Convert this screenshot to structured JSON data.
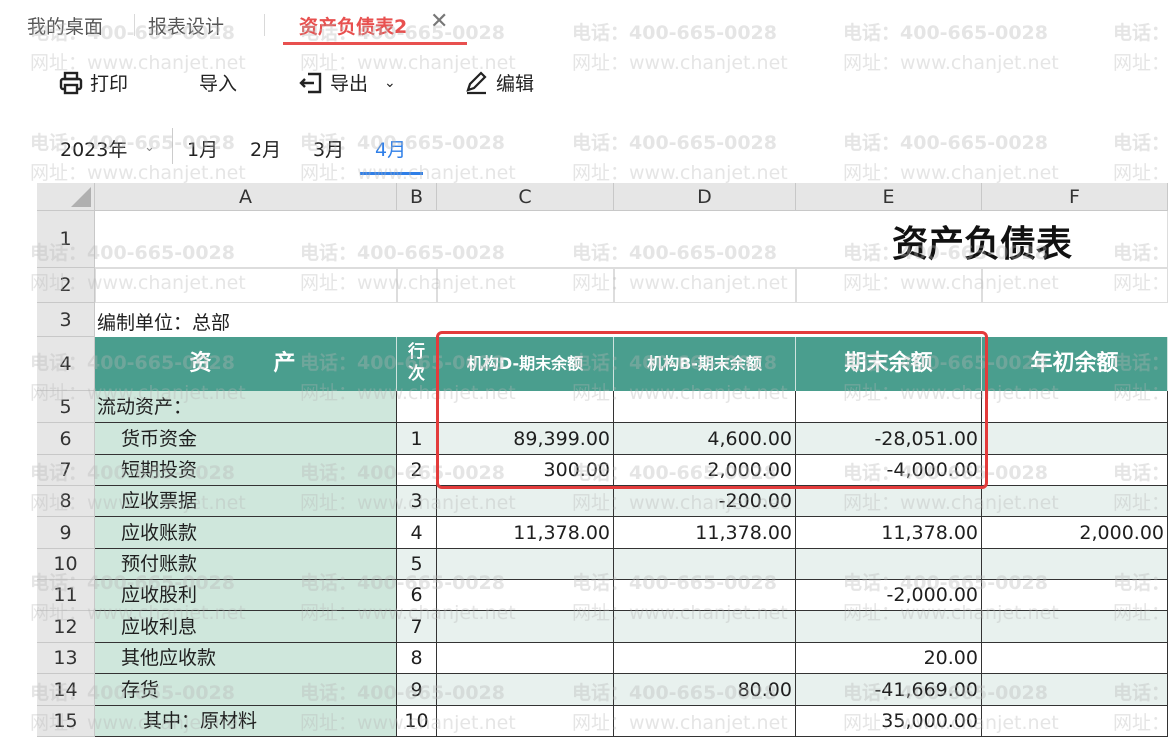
{
  "tabs": [
    {
      "label": "我的桌面"
    },
    {
      "label": "报表设计"
    },
    {
      "label": "资产负债表2",
      "active": true
    }
  ],
  "toolbar": {
    "print": "打印",
    "import": "导入",
    "export": "导出",
    "edit": "编辑"
  },
  "period": {
    "year": "2023年",
    "months": [
      "1月",
      "2月",
      "3月",
      "4月"
    ],
    "active_month": "4月"
  },
  "columns": [
    "A",
    "B",
    "C",
    "D",
    "E",
    "F"
  ],
  "sheet": {
    "title": "资产负债表",
    "unit": "编制单位：总部",
    "headers": {
      "assets": "资　　产",
      "line": "行\n次",
      "c": "机构D-期末余额",
      "d": "机构B-期末余额",
      "e": "期末余额",
      "f": "年初余额"
    },
    "rows": [
      {
        "n": "5",
        "a": "流动资产：",
        "b": "",
        "c": "",
        "d": "",
        "e": "",
        "f": ""
      },
      {
        "n": "6",
        "a": "货币资金",
        "b": "1",
        "c": "89,399.00",
        "d": "4,600.00",
        "e": "-28,051.00",
        "f": ""
      },
      {
        "n": "7",
        "a": "短期投资",
        "b": "2",
        "c": "300.00",
        "d": "2,000.00",
        "e": "-4,000.00",
        "f": ""
      },
      {
        "n": "8",
        "a": "应收票据",
        "b": "3",
        "c": "",
        "d": "-200.00",
        "e": "",
        "f": ""
      },
      {
        "n": "9",
        "a": "应收账款",
        "b": "4",
        "c": "11,378.00",
        "d": "11,378.00",
        "e": "11,378.00",
        "f": "2,000.00"
      },
      {
        "n": "10",
        "a": "预付账款",
        "b": "5",
        "c": "",
        "d": "",
        "e": "",
        "f": ""
      },
      {
        "n": "11",
        "a": "应收股利",
        "b": "6",
        "c": "",
        "d": "",
        "e": "-2,000.00",
        "f": ""
      },
      {
        "n": "12",
        "a": "应收利息",
        "b": "7",
        "c": "",
        "d": "",
        "e": "",
        "f": ""
      },
      {
        "n": "13",
        "a": "其他应收款",
        "b": "8",
        "c": "",
        "d": "",
        "e": "20.00",
        "f": ""
      },
      {
        "n": "14",
        "a": "存货",
        "b": "9",
        "c": "",
        "d": "80.00",
        "e": "-41,669.00",
        "f": ""
      },
      {
        "n": "15",
        "a": "其中：原材料",
        "b": "10",
        "c": "",
        "d": "",
        "e": "35,000.00",
        "f": ""
      }
    ]
  },
  "watermark": {
    "phone": "电话：400-665-0028",
    "site": "网址：www.chanjet.net"
  },
  "colors": {
    "accent_tab": "#e8504f",
    "accent_month": "#2f7fe8",
    "teal_header": "#4a9e8e",
    "asset_column": "#cfe7dc",
    "highlight_box": "#e33b3b"
  }
}
